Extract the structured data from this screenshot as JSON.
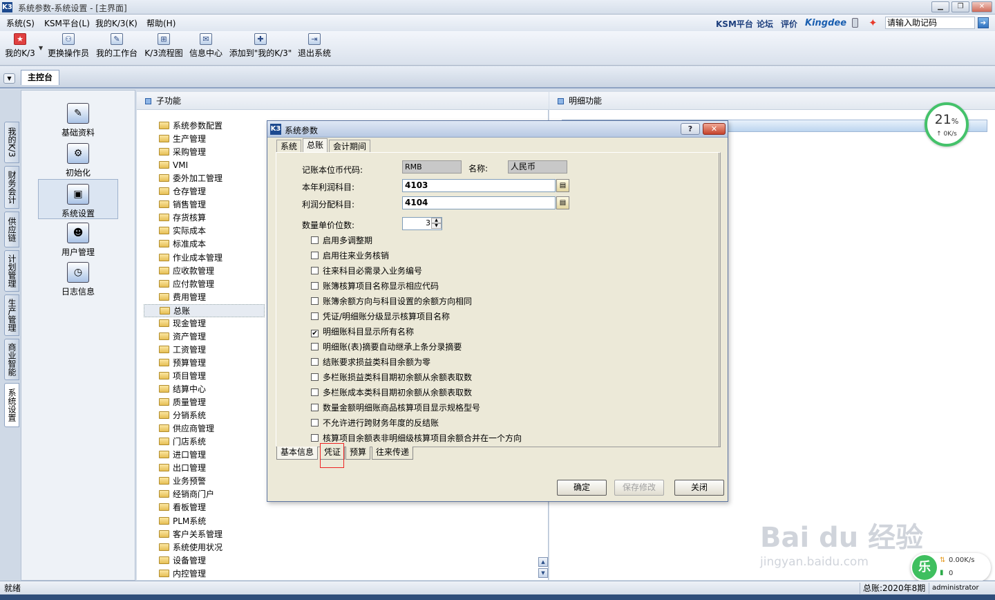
{
  "window": {
    "title": "系统参数-系统设置 - [主界面]",
    "logo": "K3"
  },
  "menubar": {
    "items": [
      "系统(S)",
      "KSM平台(L)",
      "我的K/3(K)",
      "帮助(H)"
    ],
    "brand_links": [
      "KSM平台",
      "论坛",
      "评价"
    ],
    "kingdee": "Kingdee",
    "helper_placeholder": "请输入助记码",
    "go_icon": "go-arrow-icon"
  },
  "toolbar": {
    "items": [
      "我的K/3",
      "更换操作员",
      "我的工作台",
      "K/3流程图",
      "信息中心",
      "添加到\"我的K/3\"",
      "退出系统"
    ]
  },
  "tabstrip": {
    "active_tab": "主控台"
  },
  "vertical_tabs": [
    "我的K/3",
    "财务会计",
    "供应链",
    "计划管理",
    "生产管理",
    "商业智能",
    "系统设置"
  ],
  "left_panel": {
    "items": [
      "基础资料",
      "初始化",
      "系统设置",
      "用户管理",
      "日志信息"
    ],
    "selected": "系统设置"
  },
  "subfunc": {
    "header": "子功能",
    "items": [
      "系统参数配置",
      "生产管理",
      "采购管理",
      "VMI",
      "委外加工管理",
      "仓存管理",
      "销售管理",
      "存货核算",
      "实际成本",
      "标准成本",
      "作业成本管理",
      "应收款管理",
      "应付款管理",
      "费用管理",
      "总账",
      "现金管理",
      "资产管理",
      "工资管理",
      "预算管理",
      "项目管理",
      "结算中心",
      "质量管理",
      "分销系统",
      "供应商管理",
      "门店系统",
      "进口管理",
      "出口管理",
      "业务预警",
      "经销商门户",
      "看板管理",
      "PLM系统",
      "客户关系管理",
      "系统使用状况",
      "设备管理",
      "内控管理"
    ],
    "selected": "总账"
  },
  "detail": {
    "header": "明细功能"
  },
  "netwidget": {
    "percent": "21",
    "percent_sign": "%",
    "speed": "↑ 0K/s"
  },
  "dialog": {
    "title": "系统参数",
    "help": "?",
    "close": "✕",
    "top_tabs": [
      "系统",
      "总账",
      "会计期间"
    ],
    "active_top_tab": "总账",
    "currency_code_label": "记账本位币代码:",
    "currency_code": "RMB",
    "name_label": "名称:",
    "name_value": "人民币",
    "profit_label": "本年利润科目:",
    "profit_value": "4103",
    "dist_label": "利润分配科目:",
    "dist_value": "4104",
    "qty_label": "数量单价位数:",
    "qty_value": "3",
    "checkboxes": [
      {
        "label": "启用多调整期",
        "checked": false
      },
      {
        "label": "启用往来业务核销",
        "checked": false
      },
      {
        "label": "往来科目必需录入业务编号",
        "checked": false
      },
      {
        "label": "账簿核算项目名称显示相应代码",
        "checked": false
      },
      {
        "label": "账簿余额方向与科目设置的余额方向相同",
        "checked": false
      },
      {
        "label": "凭证/明细账分级显示核算项目名称",
        "checked": false
      },
      {
        "label": "明细账科目显示所有名称",
        "checked": true
      },
      {
        "label": "明细账(表)摘要自动继承上条分录摘要",
        "checked": false
      },
      {
        "label": "结账要求损益类科目余额为零",
        "checked": false
      },
      {
        "label": "多栏账损益类科目期初余额从余额表取数",
        "checked": false
      },
      {
        "label": "多栏账成本类科目期初余额从余额表取数",
        "checked": false
      },
      {
        "label": "数量金额明细账商品核算项目显示规格型号",
        "checked": false
      },
      {
        "label": "不允许进行跨财务年度的反结账",
        "checked": false
      },
      {
        "label": "核算项目余额表非明细级核算项目余额合并在一个方向",
        "checked": false
      }
    ],
    "bottom_tabs": [
      "基本信息",
      "凭证",
      "预算",
      "往来传递"
    ],
    "active_bottom_tab": "基本信息",
    "buttons": {
      "ok": "确定",
      "save": "保存修改",
      "close": "关闭"
    }
  },
  "statusbar": {
    "ready": "就绪",
    "period": "总账:2020年8期",
    "user": "administrator"
  },
  "watermark": {
    "brand": "Bai du 经验",
    "url": "jingyan.baidu.com"
  },
  "speedbadge": {
    "logo": "乐",
    "up": "0.00K/s",
    "down": "0"
  }
}
